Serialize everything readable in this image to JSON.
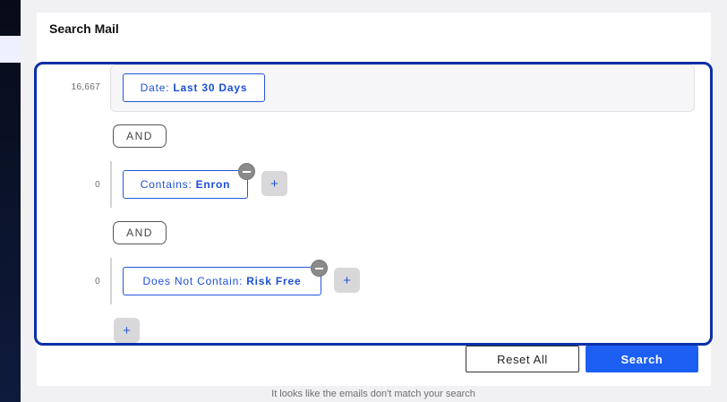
{
  "header": {
    "title": "Search Mail"
  },
  "rules": [
    {
      "count": "16,667",
      "field": "Date:",
      "value": "Last 30 Days"
    },
    {
      "count": "0",
      "field": "Contains:",
      "value": "Enron"
    },
    {
      "count": "0",
      "field": "Does Not Contain:",
      "value": "Risk Free"
    }
  ],
  "operators": [
    "AND",
    "AND"
  ],
  "buttons": {
    "add": "+",
    "reset": "Reset All",
    "search": "Search"
  },
  "footer": {
    "message": "It looks like the emails don't match your search"
  },
  "colors": {
    "accent": "#1d5ff2",
    "outline": "#0a2fa8",
    "chip": "#2756d8"
  }
}
